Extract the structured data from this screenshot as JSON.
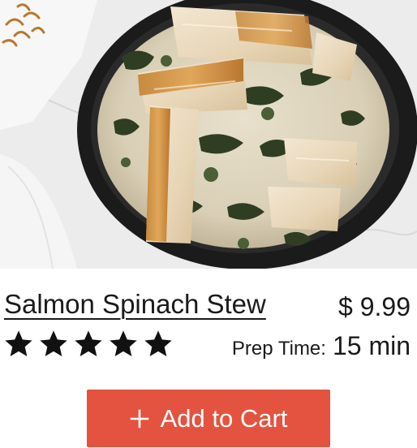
{
  "product": {
    "name": "Salmon Spinach Stew",
    "price": "$ 9.99",
    "rating": {
      "value": 5,
      "max": 5
    },
    "prep_time": {
      "label": "Prep Time:",
      "value": "15 min"
    },
    "image": {
      "icon": "salmon-stew-photo"
    }
  },
  "actions": {
    "add_to_cart": {
      "label": "Add to Cart",
      "icon": "plus-icon"
    }
  },
  "colors": {
    "accent": "#e4533f",
    "text": "#1a1a1a",
    "star": "#111111"
  }
}
